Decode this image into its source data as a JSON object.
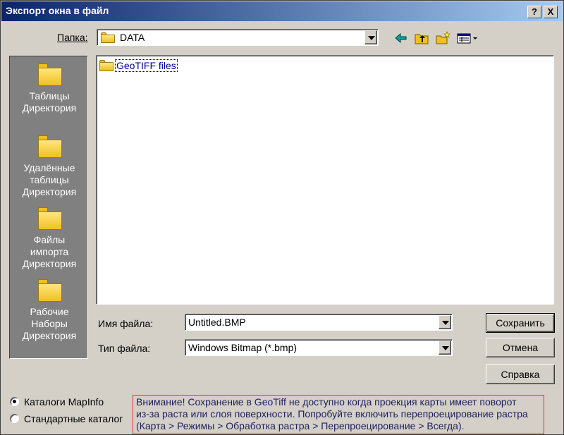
{
  "window": {
    "title": "Экспорт окна в файл",
    "help_button": "?",
    "close_button": "X"
  },
  "folder_bar": {
    "label": "Папка:",
    "value": "DATA"
  },
  "places": [
    {
      "lines": [
        "Таблицы",
        "Директория"
      ]
    },
    {
      "lines": [
        "Удалённые",
        "таблицы",
        "Директория"
      ]
    },
    {
      "lines": [
        "Файлы",
        "импорта",
        "Директория"
      ]
    },
    {
      "lines": [
        "Рабочие",
        "Наборы",
        "Директория"
      ]
    }
  ],
  "files": [
    {
      "name": "GeoTIFF files",
      "type": "folder"
    }
  ],
  "filename": {
    "label": "Имя файла:",
    "value": "Untitled.BMP"
  },
  "filetype": {
    "label": "Тип файла:",
    "value": "Windows Bitmap (*.bmp)"
  },
  "buttons": {
    "save": "Сохранить",
    "cancel": "Отмена",
    "help": "Справка"
  },
  "radios": {
    "mapinfo": "Каталоги MapInfo",
    "standard": "Стандартные каталог",
    "selected": "mapinfo"
  },
  "warning": {
    "lines": [
      "Внимание! Сохранение в GeoTiff не доступно когда проекция карты имеет поворот",
      "из-за раста или слоя поверхности. Попробуйте включить перепроецирование растра",
      "(Карта > Режимы > Обработка растра > Перепроецирование > Всегда)."
    ]
  },
  "colors": {
    "title_start": "#0a246a",
    "title_end": "#a6caf0",
    "face": "#d4d0c8",
    "places_bg": "#808080",
    "warning_border": "#e03030",
    "folder": "#f0c020"
  },
  "icons": [
    "back-arrow-icon",
    "up-folder-icon",
    "new-folder-icon",
    "view-menu-icon"
  ]
}
